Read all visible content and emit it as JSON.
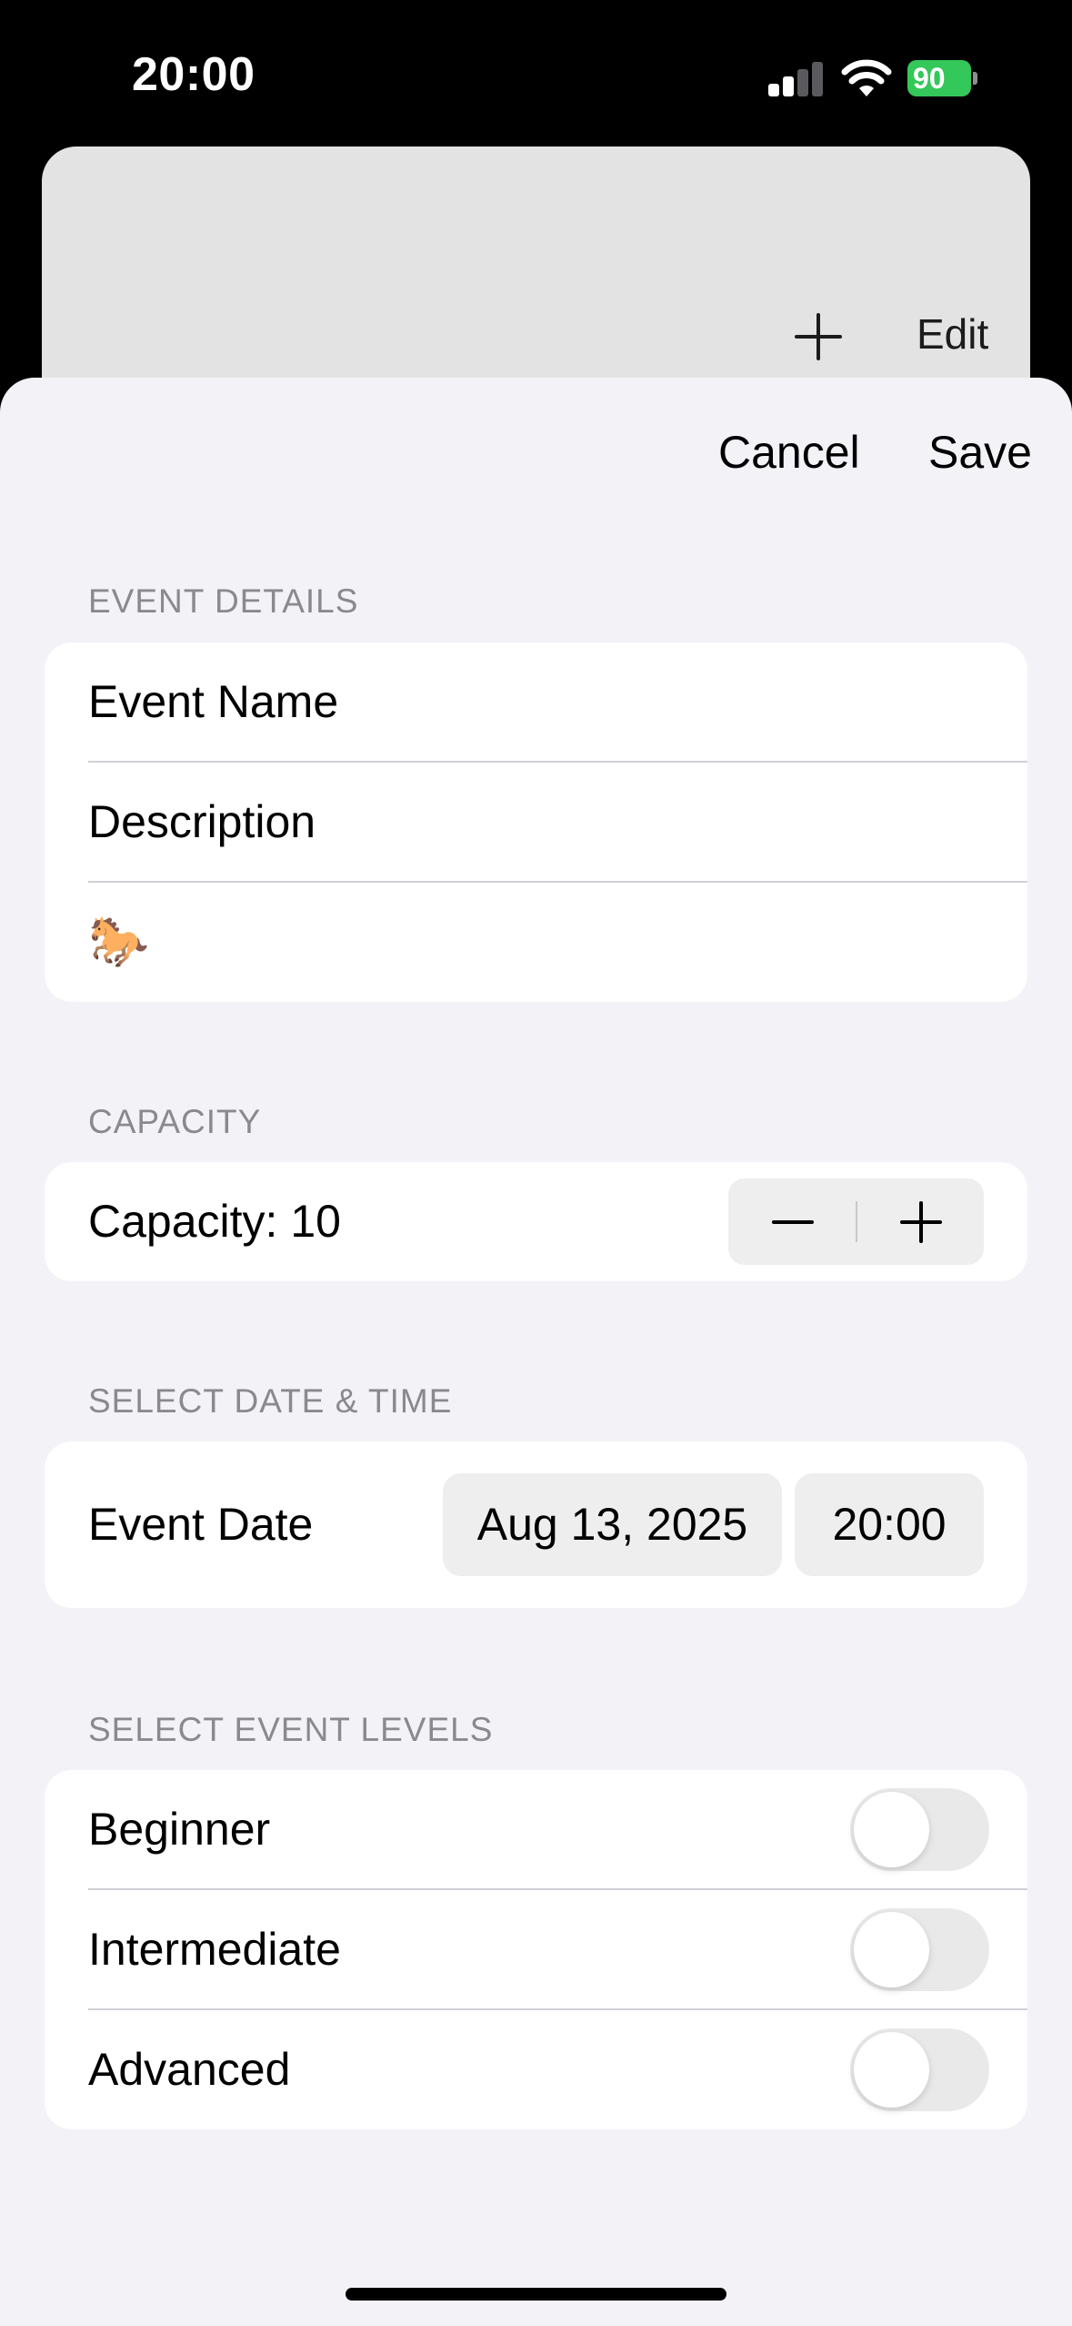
{
  "status_bar": {
    "time": "20:00",
    "battery_level": "90"
  },
  "background": {
    "add_icon": "plus-icon",
    "edit_label": "Edit"
  },
  "nav": {
    "cancel_label": "Cancel",
    "save_label": "Save"
  },
  "event_details": {
    "header": "EVENT DETAILS",
    "name_placeholder": "Event Name",
    "description_placeholder": "Description",
    "emoji": "🐎"
  },
  "capacity": {
    "header": "CAPACITY",
    "label": "Capacity: 10",
    "value": 10,
    "decrement_icon": "minus-icon",
    "increment_icon": "plus-icon"
  },
  "date_time": {
    "header": "SELECT DATE & TIME",
    "label": "Event Date",
    "date": "Aug 13, 2025",
    "time": "20:00"
  },
  "levels": {
    "header": "SELECT EVENT LEVELS",
    "items": [
      {
        "label": "Beginner",
        "on": false
      },
      {
        "label": "Intermediate",
        "on": false
      },
      {
        "label": "Advanced",
        "on": false
      }
    ]
  },
  "colors": {
    "sheet_background": "#f2f2f7",
    "card_background": "#ffffff",
    "battery_green": "#34c759",
    "section_header_gray": "#8a8a8e"
  }
}
